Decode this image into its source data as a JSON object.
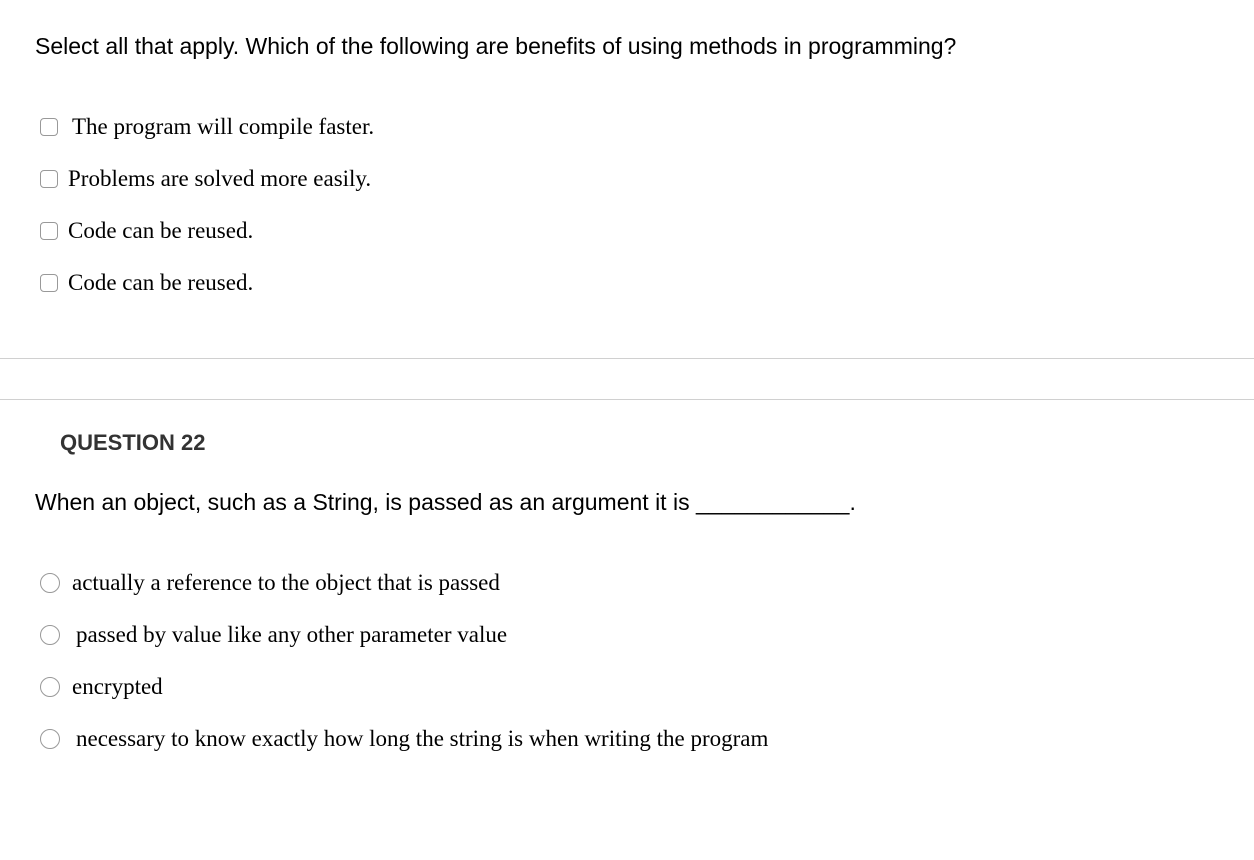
{
  "question1": {
    "prompt": "Select all that apply. Which of the following are benefits of using methods in programming?",
    "options": [
      "The program will compile faster.",
      "Problems are solved more easily.",
      "Code can be reused.",
      "Code can be reused."
    ]
  },
  "question2": {
    "header": "QUESTION 22",
    "prompt": "When an object, such as a String, is passed as an argument it is ____________.",
    "options": [
      "actually a reference to the object that is passed",
      "passed by value like any other parameter value",
      "encrypted",
      "necessary to know exactly how long the string is when writing the program"
    ]
  }
}
